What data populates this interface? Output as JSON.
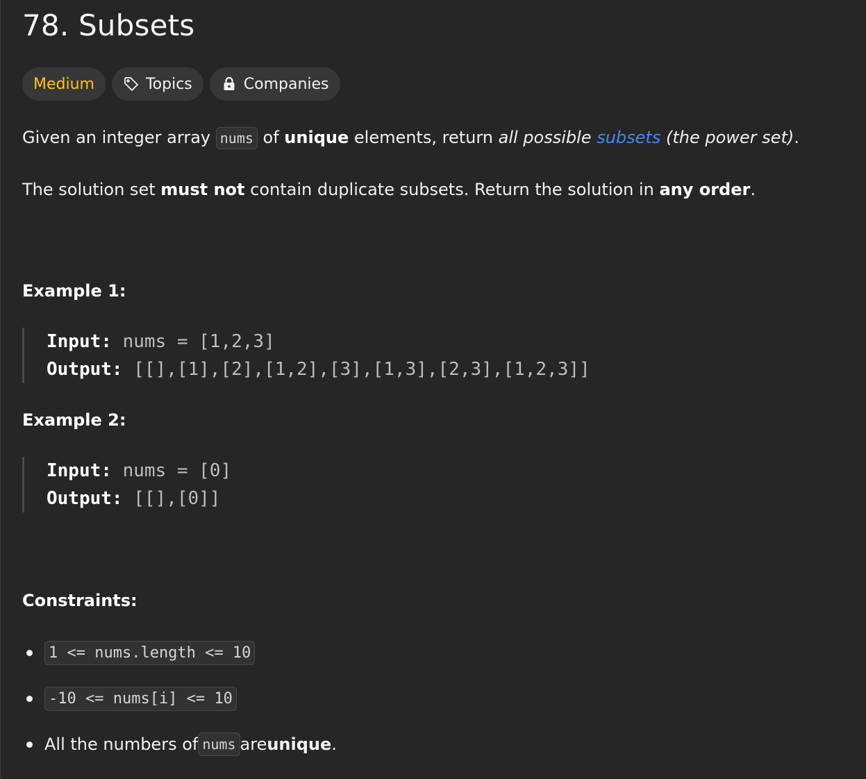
{
  "problem": {
    "title": "78. Subsets"
  },
  "tags": {
    "difficulty": "Medium",
    "topics": "Topics",
    "companies": "Companies"
  },
  "description": {
    "p1": {
      "t1": "Given an integer array ",
      "code1": "nums",
      "t2": " of ",
      "b1": "unique",
      "t3": " elements, return ",
      "i1": "all possible",
      "t4": " ",
      "link": "subsets",
      "t5": " ",
      "i2": "(the power set)",
      "t6": "."
    },
    "p2": {
      "t1": "The solution set ",
      "b1": "must not",
      "t2": " contain duplicate subsets. Return the solution in ",
      "b2": "any order",
      "t3": "."
    }
  },
  "examples": [
    {
      "heading": "Example 1:",
      "input_label": "Input:",
      "input_value": " nums = [1,2,3]",
      "output_label": "Output:",
      "output_value": " [[],[1],[2],[1,2],[3],[1,3],[2,3],[1,2,3]]"
    },
    {
      "heading": "Example 2:",
      "input_label": "Input:",
      "input_value": " nums = [0]",
      "output_label": "Output:",
      "output_value": " [[],[0]]"
    }
  ],
  "constraints": {
    "heading": "Constraints:",
    "c1": "1 <= nums.length <= 10",
    "c2": "-10 <= nums[i] <= 10",
    "c3": {
      "t1": "All the numbers of ",
      "code": "nums",
      "t2": " are ",
      "b": "unique",
      "t3": "."
    }
  },
  "colors": {
    "background": "#262626",
    "difficulty_medium": "#ffc01e",
    "link": "#3d8bf6",
    "tag_bg": "#373737"
  },
  "icons": {
    "topics": "tag-icon",
    "companies": "lock-icon"
  }
}
